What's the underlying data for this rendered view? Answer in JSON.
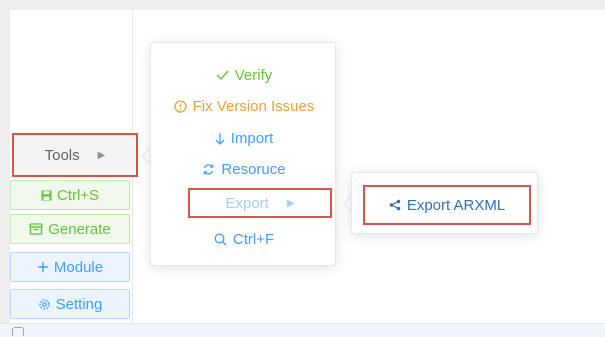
{
  "sidebar": {
    "tools_label": "Tools",
    "buttons": [
      {
        "label": "Ctrl+S",
        "icon": "save-icon",
        "color": "#67c23a"
      },
      {
        "label": "Generate",
        "icon": "archive-icon",
        "color": "#67c23a"
      },
      {
        "label": "Module",
        "icon": "plus-icon",
        "color": "#409eff"
      },
      {
        "label": "Setting",
        "icon": "gear-icon",
        "color": "#409eff"
      }
    ]
  },
  "tools_menu": {
    "items": [
      {
        "label": "Verify",
        "icon": "check-icon",
        "color": "#67c23a"
      },
      {
        "label": "Fix Version Issues",
        "icon": "warning-circle-icon",
        "color": "#e6a23c"
      },
      {
        "label": "Import",
        "icon": "arrow-down-icon",
        "color": "#409eff"
      },
      {
        "label": "Resoruce",
        "icon": "refresh-icon",
        "color": "#409eff"
      },
      {
        "label": "Export",
        "icon": "caret-right-icon",
        "color": "#a0cfff"
      },
      {
        "label": "Ctrl+F",
        "icon": "search-icon",
        "color": "#409eff"
      }
    ]
  },
  "export_menu": {
    "items": [
      {
        "label": "Export ARXML",
        "icon": "share-icon",
        "color": "#2f6fbf"
      }
    ]
  },
  "colors": {
    "highlight_border": "#d9534f",
    "success": "#67c23a",
    "primary": "#409eff",
    "warning": "#e6a23c"
  }
}
